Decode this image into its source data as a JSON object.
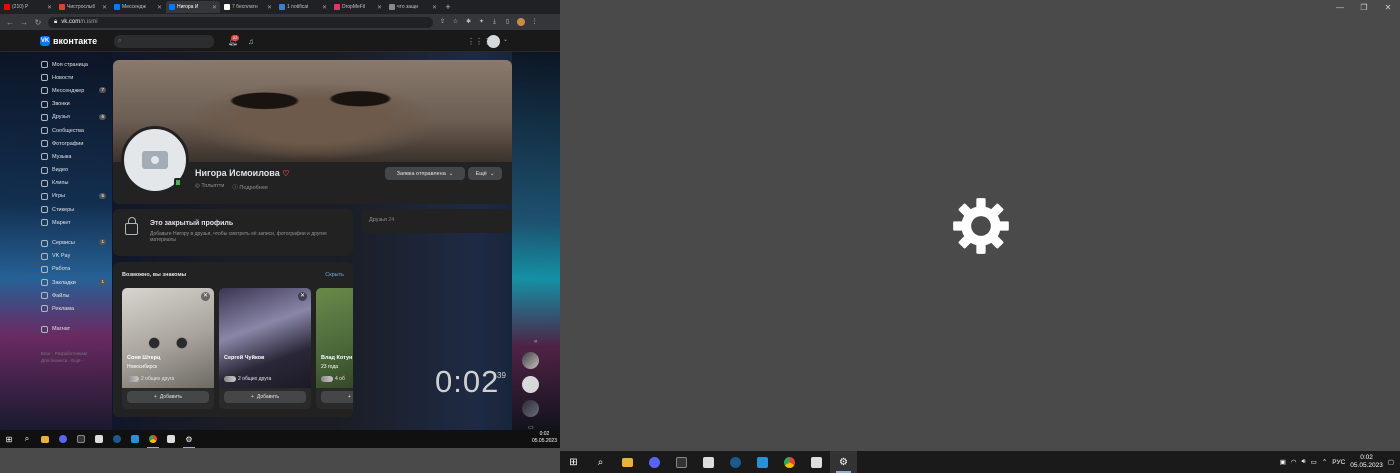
{
  "browser": {
    "tabs": [
      {
        "label": "(210) P",
        "color": "#ff0000"
      },
      {
        "label": "Чистрослыб",
        "color": "#d8452f"
      },
      {
        "label": "Мессендж",
        "color": "#0077ff"
      },
      {
        "label": "Нигора И",
        "color": "#0077ff",
        "active": true
      },
      {
        "label": "7 бесплатн",
        "color": "#ffffff"
      },
      {
        "label": "1 notificat",
        "color": "#3b7cd4"
      },
      {
        "label": "DropMeFil",
        "color": "#e0356a"
      },
      {
        "label": "что защи",
        "color": "#888888"
      }
    ],
    "url_domain": "vk.com",
    "url_path": "/n.ismi"
  },
  "vk": {
    "logo": "вконтакте",
    "notif_count": "22",
    "sidebar": [
      {
        "label": "Моя страница"
      },
      {
        "label": "Новости"
      },
      {
        "label": "Мессенджер",
        "count": "7"
      },
      {
        "label": "Звонки"
      },
      {
        "label": "Друзья",
        "count": "6"
      },
      {
        "label": "Сообщества"
      },
      {
        "label": "Фотографии"
      },
      {
        "label": "Музыка"
      },
      {
        "label": "Видео"
      },
      {
        "label": "Клипы"
      },
      {
        "label": "Игры",
        "count": "6"
      },
      {
        "label": "Стикеры"
      },
      {
        "label": "Маркет"
      },
      {
        "label": "Сервисы",
        "count": "1"
      },
      {
        "label": "VK Pay"
      },
      {
        "label": "Работа"
      },
      {
        "label": "Закладки",
        "count": "1"
      },
      {
        "label": "Файлы"
      },
      {
        "label": "Реклама"
      },
      {
        "label": "Магнат"
      }
    ],
    "footer_line1": "Блог · Разработчикам",
    "footer_line2": "Для бизнеса · Ещё ·",
    "profile": {
      "name": "Нигора Исмоилова",
      "location": "Тольятти",
      "details": "Подробнее",
      "request_button": "Заявка отправлена",
      "more_button": "Ещё"
    },
    "closed": {
      "title": "Это закрытый профиль",
      "text": "Добавьте Нигору в друзья, чтобы смотреть её записи, фотографии и другие материалы"
    },
    "friends_label": "Друзья",
    "friends_count": "24",
    "suggestions": {
      "title": "Возможно, вы знакомы",
      "hide": "Скрыть",
      "add_label": "Добавить",
      "cards": [
        {
          "name": "Соня Штерц",
          "sub": "Новосибирск",
          "mutual": "2 общих друга"
        },
        {
          "name": "Сергей Чуйков",
          "sub": "",
          "mutual": "2 общих друга"
        },
        {
          "name": "Влад Котун",
          "sub": "23 года",
          "mutual": "4 об"
        }
      ]
    },
    "clock_overlay": {
      "time": "0:02",
      "seconds": "39"
    }
  },
  "taskbar_left": {
    "time": "0:02",
    "date": "05.05.2023"
  },
  "taskbar_right": {
    "lang": "РУС",
    "time": "0:02",
    "date": "05.05.2023"
  }
}
